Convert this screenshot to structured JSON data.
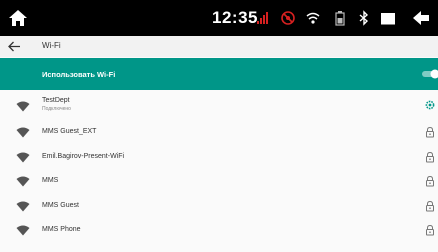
{
  "status_bar": {
    "time": "12:35",
    "icons": [
      "home-icon",
      "signal-icon",
      "no-sim-icon",
      "wifi-icon",
      "battery-icon",
      "bluetooth-icon",
      "screen-icon",
      "back-icon"
    ],
    "accent_red": "#d62020"
  },
  "toolbar": {
    "title": "Wi-Fi"
  },
  "wifi_toggle": {
    "label": "Использовать Wi-Fi",
    "enabled": true,
    "color": "#009688"
  },
  "networks": [
    {
      "name": "TestDept",
      "status": "Подключено",
      "secured": false,
      "action": "gear-icon"
    },
    {
      "name": "MMS Guest_EXT",
      "status": "",
      "secured": true,
      "action": "lock-icon"
    },
    {
      "name": "Emil.Bagirov-Present-WiFi",
      "status": "",
      "secured": true,
      "action": "lock-icon"
    },
    {
      "name": "MMS",
      "status": "",
      "secured": true,
      "action": "lock-icon"
    },
    {
      "name": "MMS Guest",
      "status": "",
      "secured": true,
      "action": "lock-icon"
    },
    {
      "name": "MMS Phone",
      "status": "",
      "secured": true,
      "action": "lock-icon"
    }
  ]
}
